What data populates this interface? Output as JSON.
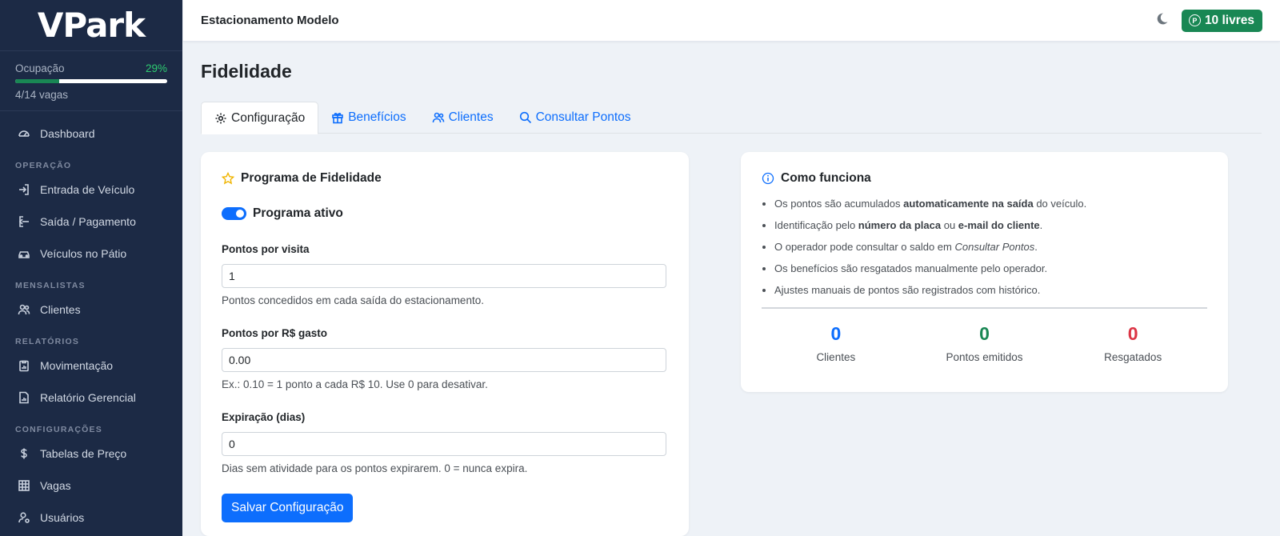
{
  "brand": "VPark",
  "occupancy": {
    "label": "Ocupação",
    "percent_text": "29%",
    "percent": 29,
    "vagas_text": "4/14 vagas"
  },
  "nav": {
    "dashboard": "Dashboard",
    "section_operacao": "OPERAÇÃO",
    "entrada": "Entrada de Veículo",
    "saida": "Saída / Pagamento",
    "patio": "Veículos no Pátio",
    "section_mensalistas": "MENSALISTAS",
    "clientes": "Clientes",
    "section_relatorios": "RELATÓRIOS",
    "movimentacao": "Movimentação",
    "gerencial": "Relatório Gerencial",
    "section_config": "CONFIGURAÇÕES",
    "tabelas": "Tabelas de Preço",
    "vagas": "Vagas",
    "usuarios": "Usuários"
  },
  "topbar": {
    "site_name": "Estacionamento Modelo",
    "badge_icon": "P",
    "free_text": "10 livres"
  },
  "page": {
    "title": "Fidelidade"
  },
  "tabs": [
    {
      "label": "Configuração",
      "icon": "gear-icon"
    },
    {
      "label": "Benefícios",
      "icon": "gift-icon"
    },
    {
      "label": "Clientes",
      "icon": "people-icon"
    },
    {
      "label": "Consultar Pontos",
      "icon": "search-icon"
    }
  ],
  "program": {
    "title": "Programa de Fidelidade",
    "toggle_label": "Programa ativo",
    "fields": [
      {
        "label": "Pontos por visita",
        "value": "1",
        "help": "Pontos concedidos em cada saída do estacionamento."
      },
      {
        "label": "Pontos por R$ gasto",
        "value": "0.00",
        "help": "Ex.: 0.10 = 1 ponto a cada R$ 10. Use 0 para desativar."
      },
      {
        "label": "Expiração (dias)",
        "value": "0",
        "help": "Dias sem atividade para os pontos expirarem. 0 = nunca expira."
      }
    ],
    "save_label": "Salvar Configuração"
  },
  "how": {
    "title": "Como funciona",
    "items": [
      {
        "a": "Os pontos são acumulados ",
        "b": "automaticamente na saída",
        "c": " do veículo."
      },
      {
        "a": "Identificação pelo ",
        "b": "número da placa",
        "c": " ou ",
        "d": "e-mail do cliente",
        "e": "."
      },
      {
        "a": "O operador pode consultar o saldo em ",
        "i": "Consultar Pontos",
        "c": "."
      },
      {
        "a": "Os benefícios são resgatados manualmente pelo operador."
      },
      {
        "a": "Ajustes manuais de pontos são registrados com histórico."
      }
    ],
    "stats": [
      {
        "value": "0",
        "label": "Clientes",
        "color": "#0d6efd"
      },
      {
        "value": "0",
        "label": "Pontos emitidos",
        "color": "#198754"
      },
      {
        "value": "0",
        "label": "Resgatados",
        "color": "#dc3545"
      }
    ]
  }
}
